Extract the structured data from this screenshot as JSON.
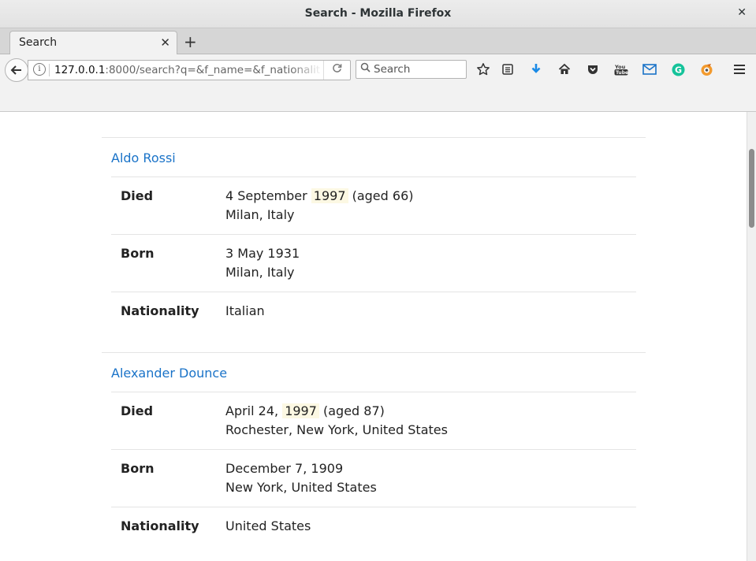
{
  "window": {
    "title": "Search - Mozilla Firefox",
    "close_icon": "close-icon"
  },
  "tab": {
    "title": "Search"
  },
  "navbar": {
    "url_host": "127.0.0.1",
    "url_rest": ":8000/search?q=&f_name=&f_nationalit",
    "search_placeholder": "Search",
    "icons": [
      "back-arrow-icon",
      "info-icon",
      "reload-icon",
      "search-icon",
      "star-icon",
      "reading-list-icon",
      "download-icon",
      "home-icon",
      "pocket-icon",
      "youtube-icon",
      "gmail-icon",
      "grammarly-icon",
      "extension-icon",
      "menu-icon"
    ]
  },
  "colors": {
    "link": "#1a73c8",
    "highlight": "#fcf8e3",
    "download": "#1a8ae6",
    "grammarly": "#15c39a",
    "gmail": "#1a73c8"
  },
  "results": [
    {
      "name": "Aldo Rossi",
      "died_label": "Died",
      "died_pre": "4 September ",
      "died_year": "1997",
      "died_post": " (aged 66)",
      "died_place": "Milan, Italy",
      "born_label": "Born",
      "born_date": "3 May 1931",
      "born_place": "Milan, Italy",
      "nationality_label": "Nationality",
      "nationality": "Italian"
    },
    {
      "name": "Alexander Dounce",
      "died_label": "Died",
      "died_pre": "April 24, ",
      "died_year": "1997",
      "died_post": " (aged 87)",
      "died_place": "Rochester, New York, United States",
      "born_label": "Born",
      "born_date": "December 7, 1909",
      "born_place": "New York, United States",
      "nationality_label": "Nationality",
      "nationality": "United States"
    }
  ]
}
